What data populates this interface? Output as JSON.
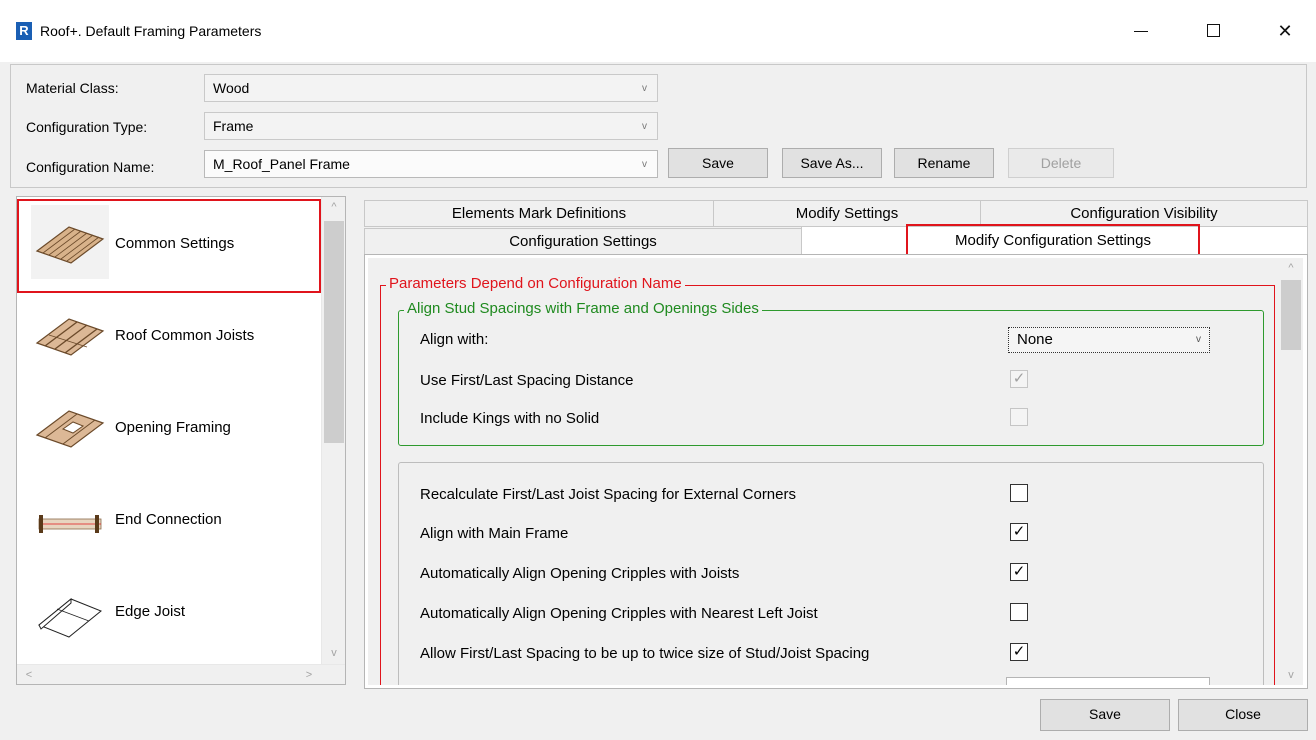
{
  "window": {
    "app_icon_letter": "R",
    "title": "Roof+. Default Framing Parameters",
    "controls": {
      "minimize": "minimize",
      "maximize": "maximize",
      "close": "✕"
    }
  },
  "header": {
    "material_class": {
      "label": "Material Class:",
      "value": "Wood"
    },
    "configuration_type": {
      "label": "Configuration Type:",
      "value": "Frame"
    },
    "configuration_name": {
      "label": "Configuration Name:",
      "value": "M_Roof_Panel Frame"
    },
    "buttons": {
      "save": "Save",
      "save_as": "Save As...",
      "rename": "Rename",
      "delete": "Delete"
    }
  },
  "sidebar": {
    "items": [
      {
        "label": "Common Settings",
        "icon": "roof-panel-icon",
        "selected": true
      },
      {
        "label": "Roof Common Joists",
        "icon": "roof-joists-icon"
      },
      {
        "label": "Opening Framing",
        "icon": "opening-framing-icon"
      },
      {
        "label": "End Connection",
        "icon": "end-connection-icon"
      },
      {
        "label": "Edge Joist",
        "icon": "edge-joist-icon"
      }
    ]
  },
  "tabs": {
    "row1": [
      "Elements Mark Definitions",
      "Modify Settings",
      "Configuration Visibility"
    ],
    "row2": [
      "Configuration Settings",
      "Modify Configuration Settings"
    ],
    "active": "Modify Configuration Settings"
  },
  "content": {
    "group_red_title": "Parameters Depend on Configuration Name",
    "group_green_title": "Align Stud Spacings with Frame and Openings Sides",
    "align_with": {
      "label": "Align with:",
      "value": "None"
    },
    "green_rows": [
      {
        "label": "Use First/Last Spacing Distance",
        "checked": true,
        "disabled": true
      },
      {
        "label": "Include Kings with no Solid",
        "checked": false,
        "disabled": true
      }
    ],
    "gray_rows": [
      {
        "label": "Recalculate First/Last Joist Spacing for External Corners",
        "checked": false
      },
      {
        "label": "Align with Main Frame",
        "checked": true
      },
      {
        "label": "Automatically Align Opening Cripples with Joists",
        "checked": true
      },
      {
        "label": "Automatically Align Opening Cripples with Nearest Left Joist",
        "checked": false
      },
      {
        "label": "Allow First/Last Spacing to be up to twice size of Stud/Joist Spacing",
        "checked": true
      }
    ]
  },
  "footer": {
    "save": "Save",
    "close": "Close"
  },
  "glyphs": {
    "check": "✓",
    "chevron_down": "v",
    "chevron_up": "^",
    "chevron_left": "<",
    "chevron_right": ">"
  },
  "colors": {
    "highlight_red": "#e0141c",
    "group_green": "#2e9a2e"
  }
}
